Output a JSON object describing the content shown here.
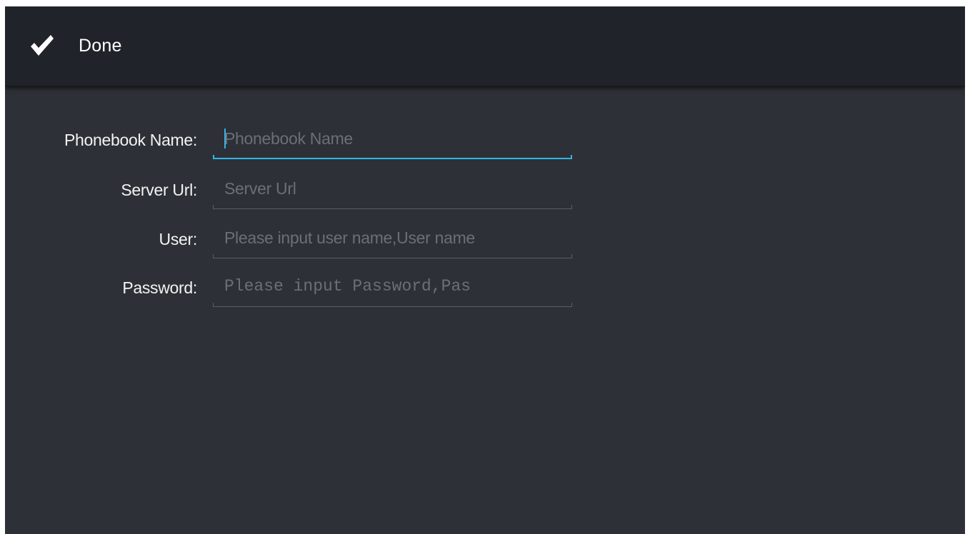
{
  "action_bar": {
    "done_icon": "checkmark-icon",
    "done_label": "Done"
  },
  "form": {
    "fields": [
      {
        "label": "Phonebook Name:",
        "value": "",
        "placeholder": "Phonebook Name",
        "focused": true
      },
      {
        "label": "Server Url:",
        "value": "",
        "placeholder": "Server Url",
        "focused": false
      },
      {
        "label": "User:",
        "value": "",
        "placeholder": "Please input user name,User name",
        "focused": false
      },
      {
        "label": "Password:",
        "value": "",
        "placeholder": "Please input Password,Pas",
        "focused": false
      }
    ]
  },
  "colors": {
    "background": "#2d3036",
    "action_bar": "#202329",
    "accent": "#33b5e5",
    "label_text": "#f3f3f3",
    "placeholder_text": "#6b6f76"
  }
}
